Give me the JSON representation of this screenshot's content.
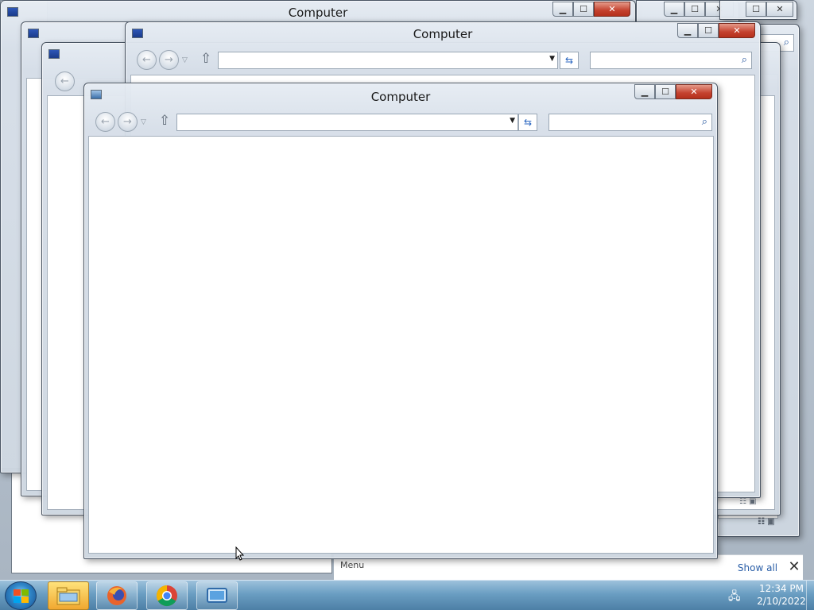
{
  "windows": {
    "title": "Computer"
  },
  "notification_bar": {
    "left_text": "Menu",
    "show_all": "Show all",
    "close_symbol": "✕"
  },
  "taskbar": {
    "apps": [
      "file-explorer-icon",
      "firefox-icon",
      "chrome-icon",
      "remote-desktop-icon"
    ],
    "clock_time": "12:34 PM",
    "clock_date": "2/10/2022"
  },
  "colors": {
    "title_close": "#c4412e",
    "taskbar": "#6a9ec2",
    "accent": "#2a66c0"
  }
}
